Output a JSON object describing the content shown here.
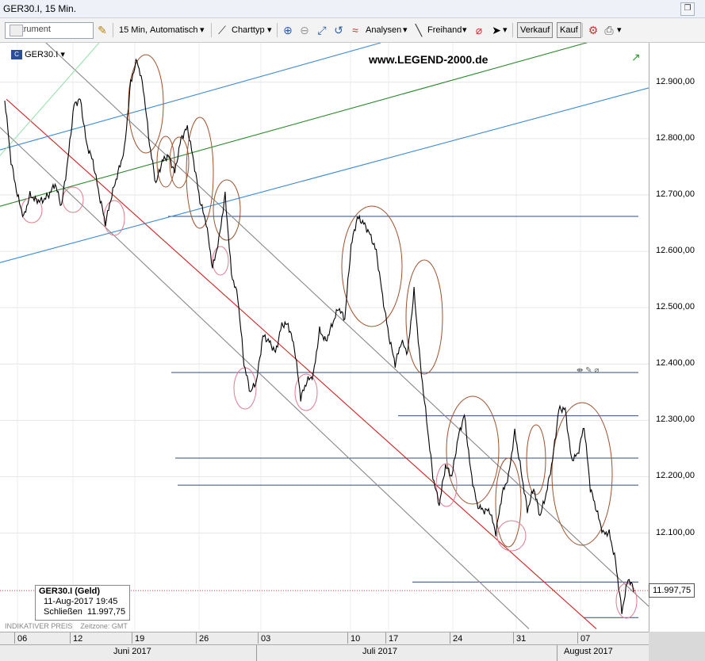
{
  "window": {
    "title": "GER30.I, 15 Min."
  },
  "toolbar": {
    "instrument_placeholder": "Instrument",
    "interval": "15 Min,",
    "mode": "Automatisch",
    "charttype": "Charttyp",
    "analysen": "Analysen",
    "freihand": "Freihand",
    "verkauf": "Verkauf",
    "kauf": "Kauf"
  },
  "chart_header": {
    "symbol": "GER30.I",
    "watermark": "www.LEGEND-2000.de"
  },
  "legend_box": {
    "name": "GER30.I (Geld)",
    "date": "11-Aug-2017 19:45",
    "close_label": "Schließen",
    "close_value": "11.997,75"
  },
  "footer": {
    "indik": "INDIKATIVER PREIS",
    "zone": "Zeitzone: GMT"
  },
  "price_label": "11.997,75",
  "chart_data": {
    "type": "line",
    "title": "GER30.I, 15 Min.",
    "ylim": [
      11925,
      12970
    ],
    "yticks": [
      12100,
      12200,
      12300,
      12400,
      12500,
      12600,
      12700,
      12800,
      12900
    ],
    "ytick_labels": [
      "12.100,00",
      "12.200,00",
      "12.300,00",
      "12.400,00",
      "12.500,00",
      "12.600,00",
      "12.700,00",
      "12.800,00",
      "12.900,00"
    ],
    "xticks": [
      "06",
      "12",
      "19",
      "26",
      "03",
      "10",
      "17",
      "24",
      "31",
      "07"
    ],
    "months": [
      "Juni 2017",
      "Juli 2017",
      "August 2017"
    ],
    "grid": true,
    "series": [
      {
        "values": [
          12870,
          12760,
          12700,
          12660,
          12700,
          12690,
          12690,
          12700,
          12720,
          12680,
          12760,
          12860,
          12870,
          12790,
          12760,
          12700,
          12650,
          12700,
          12740,
          12780,
          12900,
          12940,
          12890,
          12790,
          12720,
          12760,
          12770,
          12740,
          12800,
          12820,
          12760,
          12690,
          12650,
          12570,
          12620,
          12700,
          12560,
          12520,
          12400,
          12350,
          12370,
          12450,
          12440,
          12420,
          12470,
          12470,
          12430,
          12340,
          12370,
          12380,
          12460,
          12440,
          12470,
          12500,
          12480,
          12610,
          12660,
          12650,
          12630,
          12600,
          12520,
          12450,
          12400,
          12440,
          12420,
          12530,
          12400,
          12300,
          12200,
          12150,
          12220,
          12200,
          12270,
          12310,
          12210,
          12150,
          12140,
          12140,
          12100,
          12170,
          12200,
          12280,
          12210,
          12140,
          12180,
          12130,
          12170,
          12230,
          12320,
          12320,
          12230,
          12240,
          12290,
          12180,
          12140,
          12100,
          12100,
          12050,
          11960,
          12020,
          11998
        ]
      }
    ],
    "horizontal_levels": [
      12662,
      12385,
      12308,
      12233,
      12185,
      12013,
      11950
    ],
    "channel_lines": [
      {
        "color": "#d62020",
        "from_date": "06 Jun",
        "from_price": 12870,
        "to_date": "09 Aug",
        "to_price": 11930
      },
      {
        "color": "#888888",
        "from_date": "05 Jun",
        "from_price": 12820,
        "to_date": "03 Aug",
        "to_price": 11930
      },
      {
        "color": "#888888",
        "from_date": "10 Jun",
        "from_price": 12970,
        "to_date": "10 Aug",
        "to_price": 11970
      },
      {
        "color": "#2a8a2a",
        "from_date": "05 Jun",
        "from_price": 12680,
        "to_date": "09 Aug",
        "to_price": 12975
      },
      {
        "color": "#3a8ad8",
        "from_date": "05 Jun",
        "from_price": 12780,
        "to_date": "23 Jul",
        "to_price": 12970
      },
      {
        "color": "#3a8ad8",
        "from_date": "05 Jun",
        "from_price": 12580,
        "to_date": "11 Aug",
        "to_price": 12890
      }
    ]
  }
}
